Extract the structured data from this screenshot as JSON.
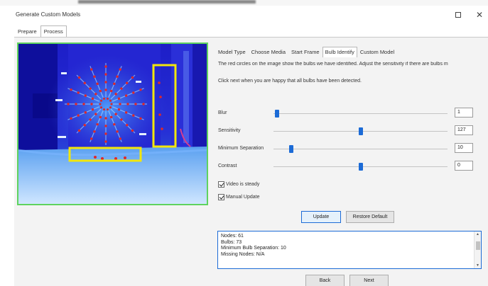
{
  "window": {
    "title": "Generate Custom Models"
  },
  "outer_tabs": [
    "Prepare",
    "Process"
  ],
  "inner_tabs": [
    "Model Type",
    "Choose Media",
    "Start Frame",
    "Bulb Identify",
    "Custom Model"
  ],
  "description": "The red circles on the image show the bulbs we have identified. Adjust the sensitivity if there are bulbs m",
  "instruction": "Click next when you are happy that all bulbs have been detected.",
  "sliders": [
    {
      "label": "Blur",
      "value": "1",
      "level": 0.02
    },
    {
      "label": "Sensitivity",
      "value": "127",
      "level": 0.5
    },
    {
      "label": "Minimum Separation",
      "value": "10",
      "level": 0.1
    },
    {
      "label": "Contrast",
      "value": "0",
      "level": 0.5
    }
  ],
  "checkboxes": [
    {
      "label": "Video is steady",
      "checked": true
    },
    {
      "label": "Manual Update",
      "checked": true
    }
  ],
  "buttons": {
    "update": "Update",
    "restore_default": "Restore Default",
    "back": "Back",
    "next": "Next"
  },
  "log_lines": [
    "Nodes: 61",
    "Bulbs: 73",
    "Minimum Bulb Separation: 10",
    "Missing Nodes: N/A"
  ],
  "colors": {
    "accent": "#1c6bd6",
    "preview_border": "#5fd35f",
    "highlight_box": "#f2e60c",
    "bulb_circle": "#e02828"
  }
}
